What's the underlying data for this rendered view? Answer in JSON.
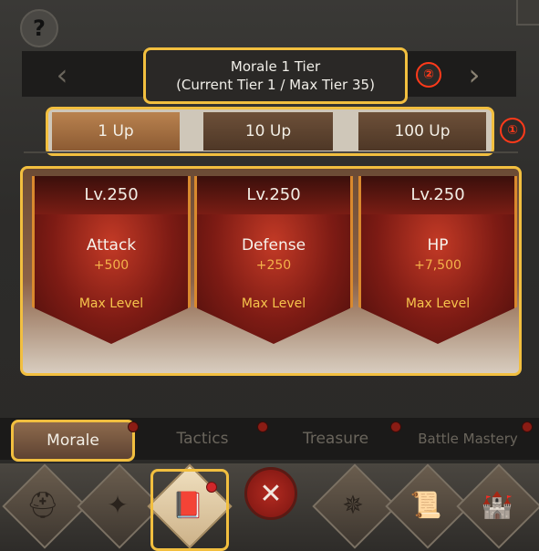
{
  "header": {
    "help_label": "?",
    "prev_label": "‹",
    "next_label": "›",
    "tier_line1": "Morale 1 Tier",
    "tier_line2": "(Current Tier 1 / Max Tier 35)",
    "callout_tier": "②"
  },
  "upgrade_step": {
    "options": [
      "1 Up",
      "10 Up",
      "100 Up"
    ],
    "selected": "1 Up",
    "callout": "①"
  },
  "cards": [
    {
      "level": "Lv.250",
      "stat": "Attack",
      "bonus": "+500",
      "status": "Max Level"
    },
    {
      "level": "Lv.250",
      "stat": "Defense",
      "bonus": "+250",
      "status": "Max Level"
    },
    {
      "level": "Lv.250",
      "stat": "HP",
      "bonus": "+7,500",
      "status": "Max Level"
    }
  ],
  "tabs": [
    {
      "label": "Morale"
    },
    {
      "label": "Tactics"
    },
    {
      "label": "Treasure"
    },
    {
      "label": "Battle Mastery"
    }
  ],
  "bottom_bar": {
    "close_label": "✕",
    "icons": [
      "helmet-icon",
      "scroll-crate-icon",
      "book-icon",
      "eagle-emblem-icon",
      "scroll-icon",
      "castle-icon"
    ]
  },
  "colors": {
    "highlight": "#f2bf3f",
    "callout": "#ff3a1a"
  }
}
